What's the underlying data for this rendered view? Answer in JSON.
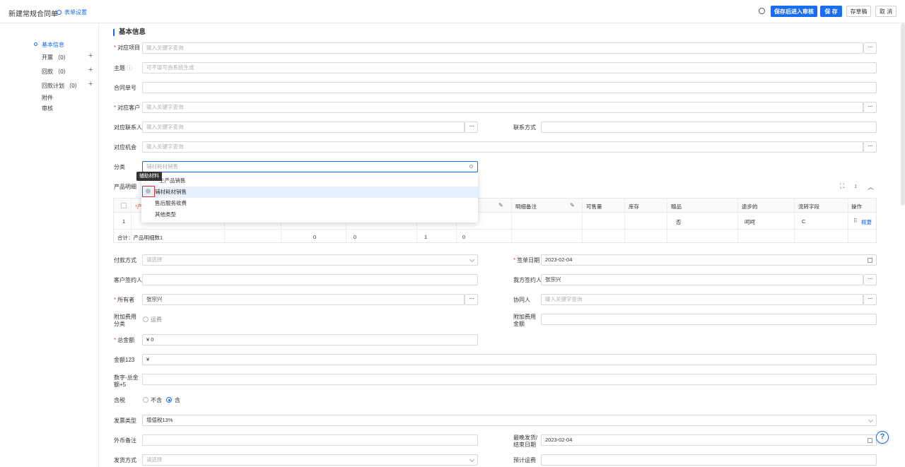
{
  "header": {
    "title": "新建常规合同单",
    "form_settings": "表单设置",
    "btn_submit_review": "保存后进入审核",
    "btn_save": "保 存",
    "btn_draft": "存草稿",
    "btn_cancel": "取 消"
  },
  "sidebar": {
    "basic": "基本信息",
    "invoice": "开票 （0）",
    "payment": "回款 （0）",
    "payment_plan": "回款计划 （0）",
    "attachment": "附件",
    "audit": "审核"
  },
  "section": {
    "title": "基本信息"
  },
  "fields": {
    "project_label": "对应项目",
    "project_ph": "输入关键字查询",
    "subject_label": "主题",
    "subject_ph": "可不填写由系统生成",
    "contract_no_label": "合同单号",
    "customer_label": "对应客户",
    "customer_ph": "输入关键字查询",
    "contact_label": "对应联系人",
    "contact_ph": "输入关键字查询",
    "contact_method_label": "联系方式",
    "opportunity_label": "对应机会",
    "opportunity_ph": "输入关键字查询",
    "category_label": "分类",
    "category_value": "辅材耗材销售",
    "product_detail_label": "产品明细",
    "payment_method_label": "付款方式",
    "payment_method_ph": "请选择",
    "sign_date_label": "签单日期",
    "sign_date_value": "2023-02-04",
    "customer_signer_label": "客户签约人",
    "our_signer_label": "我方签约人",
    "our_signer_value": "张宗兴",
    "owner_label": "所有者",
    "owner_value": "张宗兴",
    "collaborator_label": "协同人",
    "collaborator_ph": "输入关键字查询",
    "extra_fee_cat_label": "附加费用分类",
    "extra_fee_option": "运费",
    "extra_fee_amount_label": "附加费用金额",
    "total_amount_label": "总金额",
    "total_amount_value": "¥ 0",
    "amount123_label": "金额123",
    "amount123_value": "¥",
    "number_total_label": "数字-总金额+5",
    "tax_label": "含税",
    "tax_no": "不含",
    "tax_yes": "含",
    "invoice_type_label": "发票类型",
    "invoice_type_value": "增值税13%",
    "foreign_note_label": "外币备注",
    "last_ship_label": "最晚发货/结束日期",
    "last_ship_value": "2023-02-04",
    "ship_method_label": "发货方式",
    "ship_method_ph": "请选择",
    "est_freight_label": "预计运费"
  },
  "dropdown": {
    "tooltip": "辅助材料",
    "items": [
      "主产品销售",
      "辅材耗材销售",
      "售后服务收费",
      "其他类型"
    ]
  },
  "table": {
    "headers": {
      "product_short": "*产",
      "detail_note": "明细备注",
      "available": "可售量",
      "stock": "库存",
      "gift": "赠品",
      "travel": "途步的",
      "flow_field": "流转字段",
      "action": "操作"
    },
    "row": {
      "index": "1",
      "gift": "否",
      "travel": "呵呵",
      "flow_field": "C",
      "action": "概要"
    },
    "summary": {
      "label": "合计：产品明细数1",
      "v1": "0",
      "v2": "0",
      "v3": "1",
      "v4": "0"
    }
  },
  "help": {
    "label": "?"
  }
}
